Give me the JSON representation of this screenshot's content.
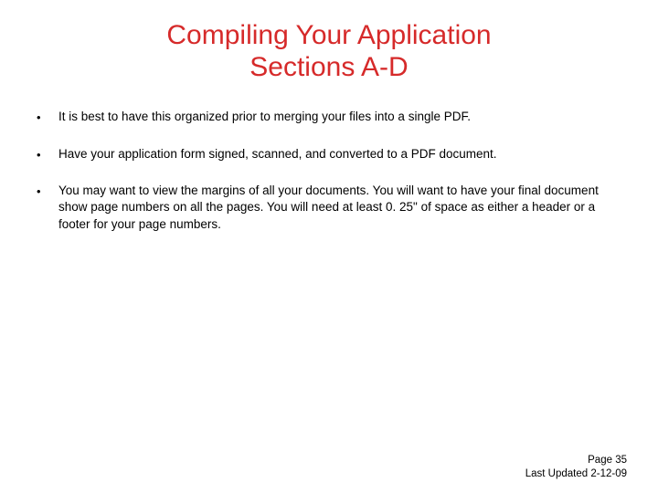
{
  "title_line1": "Compiling Your Application",
  "title_line2": "Sections A-D",
  "bullets": [
    "It is best to have this organized prior to merging your files into a single PDF.",
    "Have your application form signed, scanned, and converted to a PDF document.",
    "You may want to view the margins of all your documents. You will want to have your final document show page numbers on all the pages. You will need at least 0. 25\" of space as either a header or a footer for your page numbers."
  ],
  "footer": {
    "page": "Page 35",
    "updated": "Last Updated 2-12-09"
  }
}
